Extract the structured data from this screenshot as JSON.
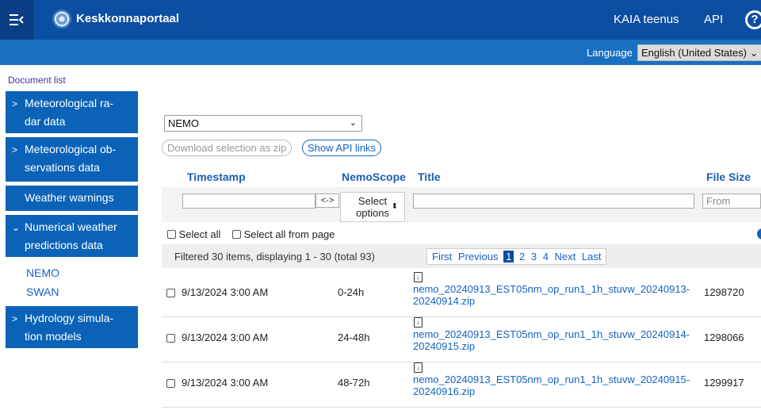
{
  "header": {
    "title": "Keskkonnaportaal",
    "nav": [
      "KAIA teenus",
      "API"
    ],
    "help_glyph": "?"
  },
  "language": {
    "label": "Language",
    "selected": "English (United States) ⌄"
  },
  "sidebar": {
    "heading": "Document list",
    "items": [
      {
        "line1": "Meteorological ra-",
        "line2": "dar data",
        "chevron": ">"
      },
      {
        "line1": "Meteorological ob-",
        "line2": "servations data",
        "chevron": ">"
      },
      {
        "line1": "Weather warnings",
        "line2": "",
        "chevron": ""
      },
      {
        "line1": "Numerical weather",
        "line2": "predictions data",
        "chevron": "⌄"
      },
      {
        "line1": "Hydrology simula-",
        "line2": "tion models",
        "chevron": ">"
      }
    ],
    "subitems": [
      "NEMO",
      "SWAN"
    ]
  },
  "main": {
    "scope_selected": "NEMO",
    "scope_caret": "⌄",
    "download_zip": "Download selection as zip",
    "show_api": "Show API links",
    "columns": {
      "timestamp": "Timestamp",
      "nemoscope": "NemoScope",
      "title": "Title",
      "filesize": "File Size"
    },
    "filter": {
      "range_toggle": "<->",
      "options_line1": "Select",
      "options_line2": "options",
      "options_arrows": "⬍",
      "from_placeholder": "From"
    },
    "select_all": "Select all",
    "select_page": "Select all from page",
    "status": "Filtered 30 items, displaying 1 - 30 (total 93)",
    "pager": {
      "first": "First",
      "previous": "Previous",
      "pages": [
        "1",
        "2",
        "3",
        "4"
      ],
      "next": "Next",
      "last": "Last"
    },
    "rows": [
      {
        "timestamp": "9/13/2024 3:00 AM",
        "scope": "0-24h",
        "title_line1": "nemo_20240913_EST05nm_op_run1_1h_stuvw_20240913-",
        "title_line2": "20240914.zip",
        "size": "1298720"
      },
      {
        "timestamp": "9/13/2024 3:00 AM",
        "scope": "24-48h",
        "title_line1": "nemo_20240913_EST05nm_op_run1_1h_stuvw_20240914-",
        "title_line2": "20240915.zip",
        "size": "1298066"
      },
      {
        "timestamp": "9/13/2024 3:00 AM",
        "scope": "48-72h",
        "title_line1": "nemo_20240913_EST05nm_op_run1_1h_stuvw_20240915-",
        "title_line2": "20240916.zip",
        "size": "1299917"
      }
    ]
  },
  "colors": {
    "topbar": "#0b4ea2",
    "langbar": "#1a6fc1",
    "sidebar": "#0b63b8",
    "link": "#1462c2"
  }
}
